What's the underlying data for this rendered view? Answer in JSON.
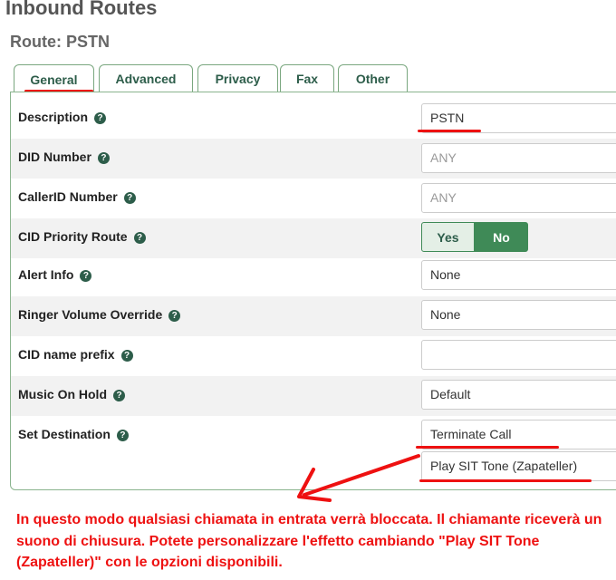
{
  "page": {
    "title": "Inbound Routes",
    "route_title": "Route: PSTN"
  },
  "tabs": [
    {
      "label": "General",
      "active": true
    },
    {
      "label": "Advanced"
    },
    {
      "label": "Privacy"
    },
    {
      "label": "Fax"
    },
    {
      "label": "Other"
    }
  ],
  "form": {
    "description": {
      "label": "Description",
      "value": "PSTN"
    },
    "did_number": {
      "label": "DID Number",
      "placeholder": "ANY"
    },
    "callerid_number": {
      "label": "CallerID Number",
      "placeholder": "ANY"
    },
    "cid_priority": {
      "label": "CID Priority Route",
      "yes": "Yes",
      "no": "No",
      "selected": "No"
    },
    "alert_info": {
      "label": "Alert Info",
      "value": "None"
    },
    "ringer_volume": {
      "label": "Ringer Volume Override",
      "value": "None"
    },
    "cid_prefix": {
      "label": "CID name prefix",
      "value": ""
    },
    "music_on_hold": {
      "label": "Music On Hold",
      "value": "Default"
    },
    "set_destination": {
      "label": "Set Destination",
      "value": "Terminate Call",
      "sub_value": "Play SIT Tone (Zapateller)"
    }
  },
  "help_glyph": "?",
  "annotation": {
    "text": "In questo modo qualsiasi chiamata in entrata verrà bloccata. Il chiamante riceverà un suono di chiusura. Potete personalizzare l'effetto cambiando \"Play SIT Tone (Zapateller)\" con le opzioni disponibili.",
    "color": "#ee1111"
  },
  "colors": {
    "accent": "#2d5d4a",
    "toggle_selected": "#3f8a57",
    "tab_border": "#7aa77f"
  }
}
